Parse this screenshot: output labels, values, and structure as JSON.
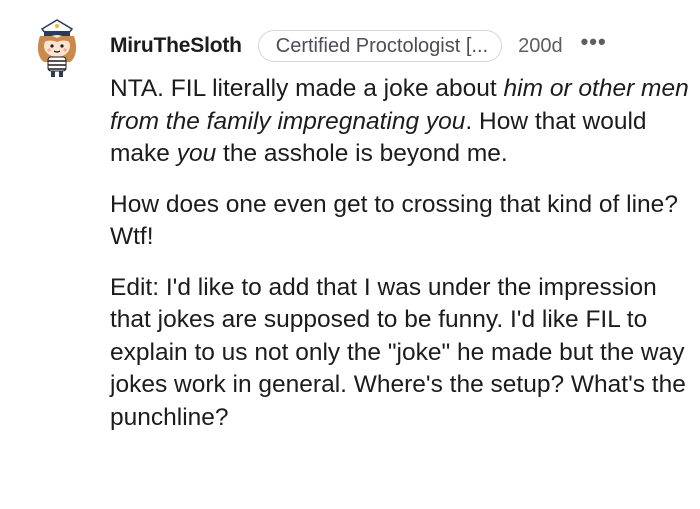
{
  "comment": {
    "username": "MiruTheSloth",
    "flair": "Certified Proctologist [...",
    "timestamp": "200d",
    "more_icon": "more-horizontal-icon",
    "avatar": "snoo-avatar-sailor",
    "paragraphs": {
      "p1": {
        "t1": "NTA. FIL literally made a joke about ",
        "t2": "him or other men from the family impregnating you",
        "t3": ". How that would make ",
        "t4": "you",
        "t5": " the asshole is beyond me."
      },
      "p2": "How does one even get to crossing that kind of line? Wtf!",
      "p3": "Edit: I'd like to add that I was under the impression that jokes are supposed to be funny. I'd like FIL to explain to us not only the \"joke\" he made but the way jokes work in general. Where's the setup? What's the punchline?"
    }
  }
}
